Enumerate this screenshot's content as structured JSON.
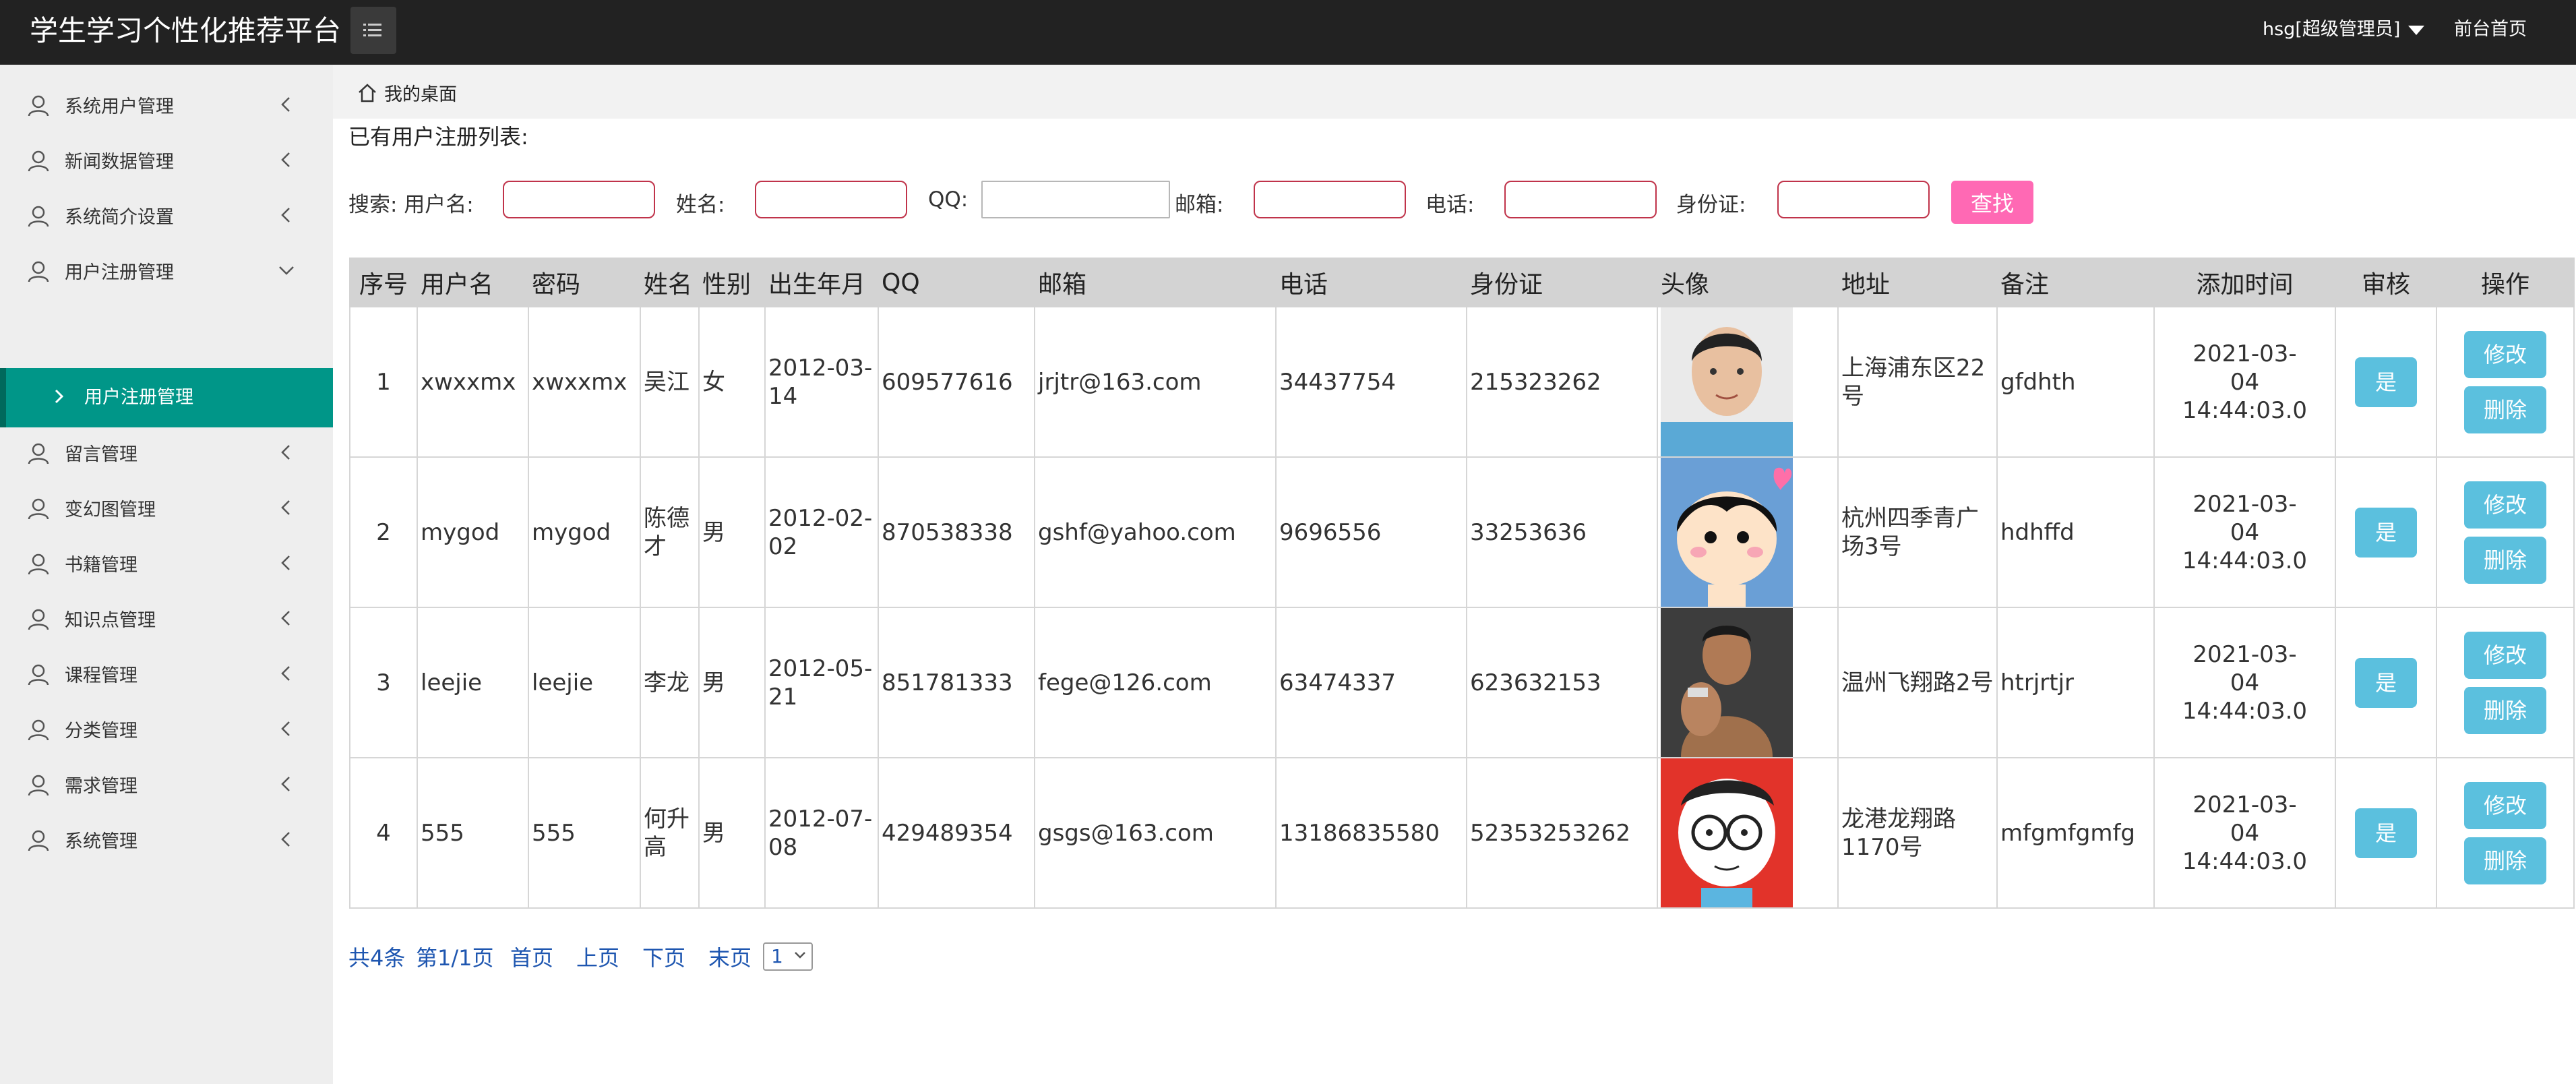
{
  "app": {
    "title": "学生学习个性化推荐平台"
  },
  "topbar": {
    "user": "hsg[超级管理员]",
    "front_link": "前台首页"
  },
  "sidebar": {
    "items": [
      {
        "label": "系统用户管理"
      },
      {
        "label": "新闻数据管理"
      },
      {
        "label": "系统简介设置"
      },
      {
        "label": "用户注册管理"
      },
      {
        "label": "留言管理"
      },
      {
        "label": "变幻图管理"
      },
      {
        "label": "书籍管理"
      },
      {
        "label": "知识点管理"
      },
      {
        "label": "课程管理"
      },
      {
        "label": "分类管理"
      },
      {
        "label": "需求管理"
      },
      {
        "label": "系统管理"
      }
    ],
    "active_sub": "用户注册管理"
  },
  "breadcrumb": {
    "label": "我的桌面"
  },
  "page": {
    "section_title": "已有用户注册列表:"
  },
  "search": {
    "prefix": "搜索: 用户名:",
    "name_label": "姓名:",
    "qq_label": "QQ:",
    "email_label": "邮箱:",
    "phone_label": "电话:",
    "id_label": "身份证:",
    "button": "查找"
  },
  "table": {
    "headers": [
      "序号",
      "用户名",
      "密码",
      "姓名",
      "性别",
      "出生年月",
      "QQ",
      "邮箱",
      "电话",
      "身份证",
      "头像",
      "地址",
      "备注",
      "添加时间",
      "审核",
      "操作"
    ],
    "rows": [
      {
        "no": "1",
        "username": "xwxxmx",
        "password": "xwxxmx",
        "name": "吴江",
        "gender": "女",
        "birth": "2012-03-14",
        "qq": "609577616",
        "email": "jrjtr@163.com",
        "phone": "34437754",
        "idcard": "215323262",
        "address": "上海浦东区22号",
        "note": "gfdhth",
        "added": "2021-03-04 14:44:03.0",
        "audit": "是"
      },
      {
        "no": "2",
        "username": "mygod",
        "password": "mygod",
        "name": "陈德才",
        "gender": "男",
        "birth": "2012-02-02",
        "qq": "870538338",
        "email": "gshf@yahoo.com",
        "phone": "9696556",
        "idcard": "33253636",
        "address": "杭州四季青广场3号",
        "note": "hdhffd",
        "added": "2021-03-04 14:44:03.0",
        "audit": "是"
      },
      {
        "no": "3",
        "username": "leejie",
        "password": "leejie",
        "name": "李龙",
        "gender": "男",
        "birth": "2012-05-21",
        "qq": "851781333",
        "email": "fege@126.com",
        "phone": "63474337",
        "idcard": "623632153",
        "address": "温州飞翔路2号",
        "note": "htrjrtjr",
        "added": "2021-03-04 14:44:03.0",
        "audit": "是"
      },
      {
        "no": "4",
        "username": "555",
        "password": "555",
        "name": "何升高",
        "gender": "男",
        "birth": "2012-07-08",
        "qq": "429489354",
        "email": "gsgs@163.com",
        "phone": "13186835580",
        "idcard": "52353253262",
        "address": "龙港龙翔路1170号",
        "note": "mfgmfgmfg",
        "added": "2021-03-04 14:44:03.0",
        "audit": "是"
      }
    ],
    "edit_label": "修改",
    "delete_label": "删除"
  },
  "pagination": {
    "total": "共4条",
    "page_info": "第1/1页",
    "first": "首页",
    "prev": "上页",
    "next": "下页",
    "last": "末页",
    "select_value": "1"
  },
  "colors": {
    "topbar": "#222222",
    "sidebar": "#eeeeee",
    "active": "#009688",
    "find_button": "#ff69b4",
    "action_button": "#5bc0de",
    "link": "#1e56b0"
  }
}
